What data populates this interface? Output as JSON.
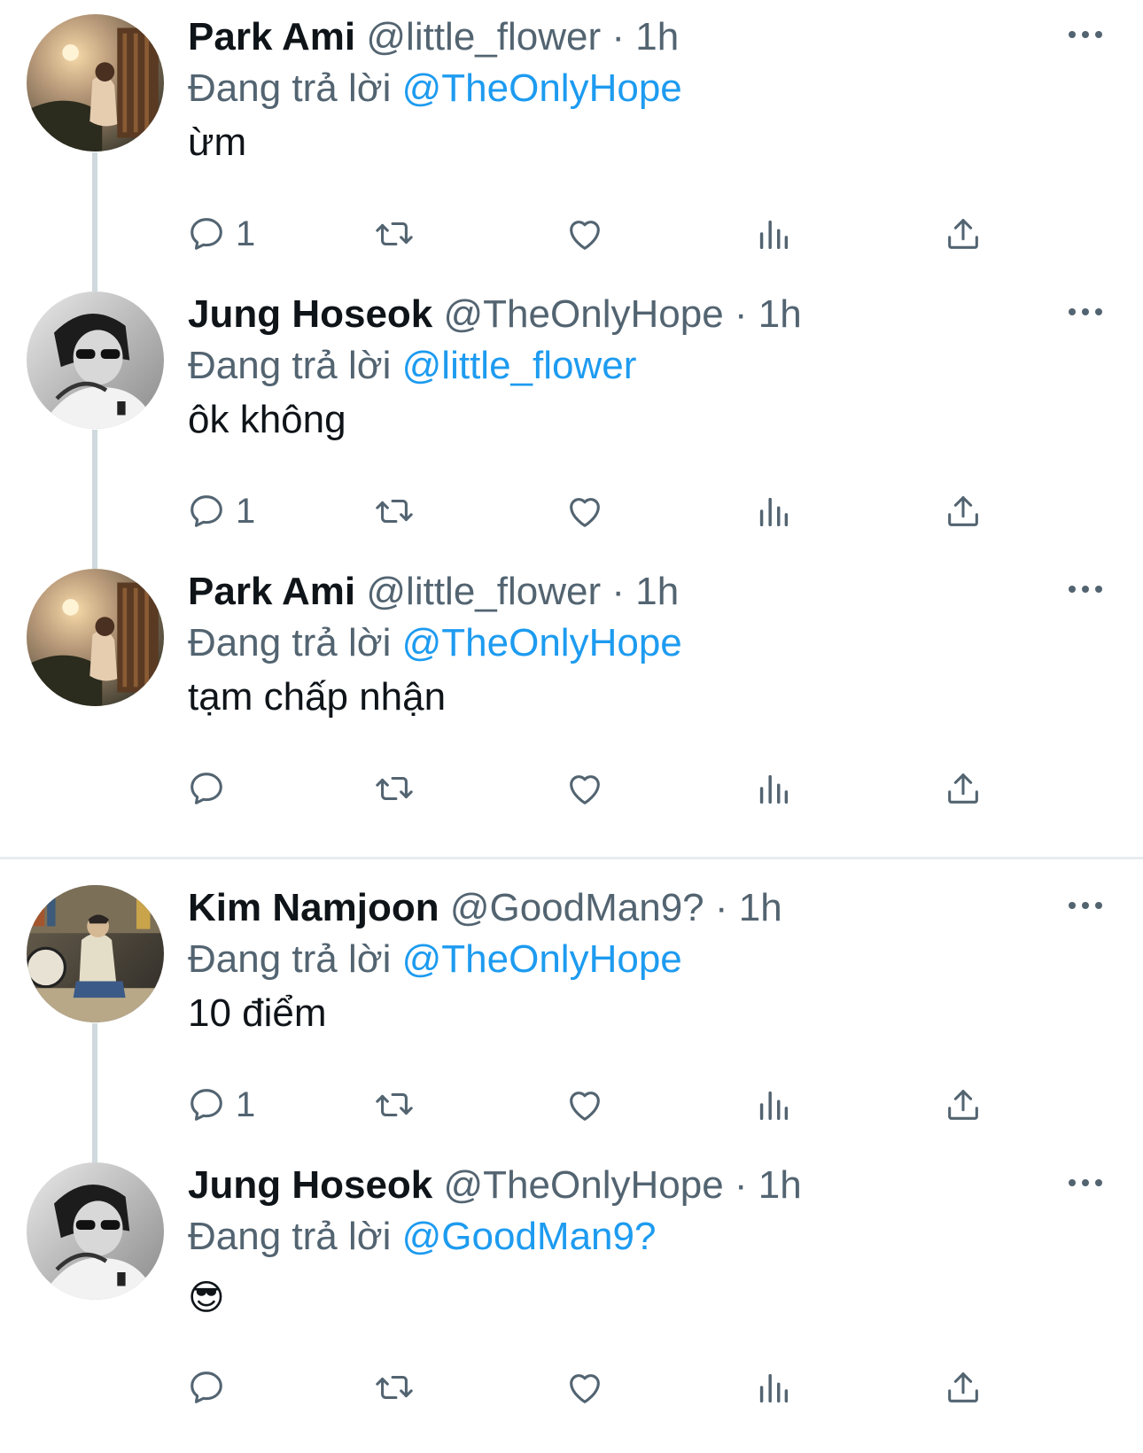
{
  "tweets": [
    {
      "name": "Park Ami",
      "handle": "@little_flower",
      "time": "· 1h",
      "reply_prefix": "Đang trả lời",
      "reply_to": "@TheOnlyHope",
      "text": "ừm",
      "reply_count": "1",
      "avatar": "sunset-balcony-photo"
    },
    {
      "name": "Jung Hoseok",
      "handle": "@TheOnlyHope",
      "time": "· 1h",
      "reply_prefix": "Đang trả lời",
      "reply_to": "@little_flower",
      "text": "ôk không",
      "reply_count": "1",
      "avatar": "black-white-sunglasses-photo"
    },
    {
      "name": "Park Ami",
      "handle": "@little_flower",
      "time": "· 1h",
      "reply_prefix": "Đang trả lời",
      "reply_to": "@TheOnlyHope",
      "text": "tạm chấp nhận",
      "reply_count": "",
      "avatar": "sunset-balcony-photo"
    },
    {
      "name": "Kim Namjoon",
      "handle": "@GoodMan9?",
      "time": "· 1h",
      "reply_prefix": "Đang trả lời",
      "reply_to": "@TheOnlyHope",
      "text": "10 điểm",
      "reply_count": "1",
      "avatar": "studio-room-photo"
    },
    {
      "name": "Jung Hoseok",
      "handle": "@TheOnlyHope",
      "time": "· 1h",
      "reply_prefix": "Đang trả lời",
      "reply_to": "@GoodMan9?",
      "text": "😎",
      "reply_count": "",
      "avatar": "black-white-sunglasses-photo"
    }
  ],
  "icons": {
    "reply": "speech-bubble-icon",
    "retweet": "retweet-icon",
    "like": "heart-icon",
    "views": "bar-chart-icon",
    "share": "share-icon",
    "more": "more-dots-icon"
  },
  "colors": {
    "mention": "#1d9bf0",
    "secondary_text": "#536471",
    "thread_line": "#cfd9de"
  }
}
